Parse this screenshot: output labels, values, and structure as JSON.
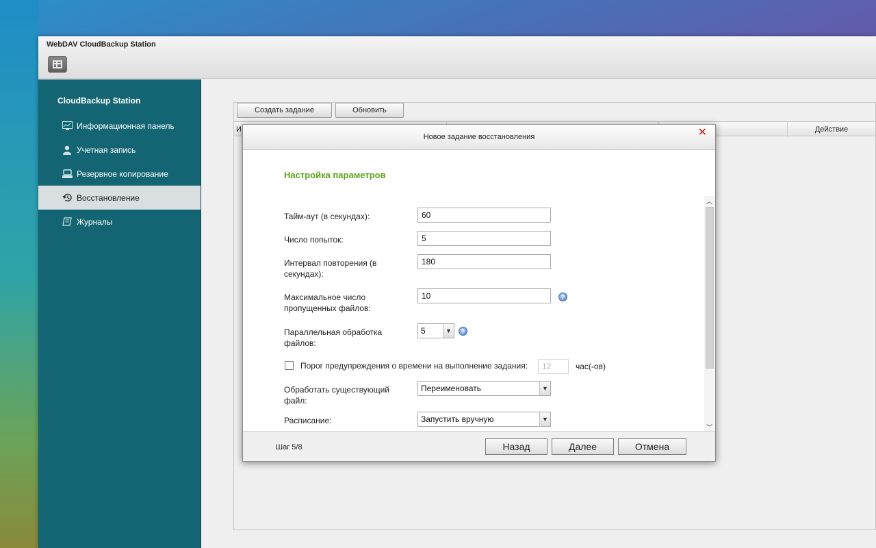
{
  "window": {
    "title": "WebDAV CloudBackup Station"
  },
  "sidebar": {
    "app_name": "CloudBackup Station",
    "items": [
      {
        "label": "Информационная панель",
        "icon": "dashboard-icon"
      },
      {
        "label": "Учетная запись",
        "icon": "user-icon"
      },
      {
        "label": "Резервное копирование",
        "icon": "backup-icon"
      },
      {
        "label": "Восстановление",
        "icon": "restore-icon",
        "active": true
      },
      {
        "label": "Журналы",
        "icon": "logs-icon"
      }
    ]
  },
  "toolbar": {
    "create_label": "Создать задание",
    "refresh_label": "Обновить"
  },
  "grid": {
    "col_first": "И",
    "col_action": "Действие"
  },
  "dialog": {
    "title": "Новое задание восстановления",
    "section_title": "Настройка параметров",
    "fields": {
      "timeout_label": "Тайм-аут (в секундах):",
      "timeout_value": "60",
      "retries_label": "Число попыток:",
      "retries_value": "5",
      "interval_label": "Интервал повторения (в секундах):",
      "interval_value": "180",
      "max_skipped_label": "Максимальное число пропущенных файлов:",
      "max_skipped_value": "10",
      "parallel_label": "Параллельная обработка файлов:",
      "parallel_value": "5",
      "threshold_label": "Порог предупреждения о времени на выполнение задания:",
      "threshold_placeholder": "12",
      "threshold_unit": "час(-ов)",
      "existing_file_label": "Обработать существующий файл:",
      "existing_file_value": "Переименовать",
      "schedule_label": "Расписание:",
      "schedule_value": "Запустить вручную"
    },
    "footer": {
      "step": "Шаг 5/8",
      "back_label": "Назад",
      "next_label": "Далее",
      "cancel_label": "Отмена"
    }
  },
  "colors": {
    "sidebar_bg": "#136573",
    "section_title": "#5aa51a",
    "close_x": "#d01a1a"
  }
}
